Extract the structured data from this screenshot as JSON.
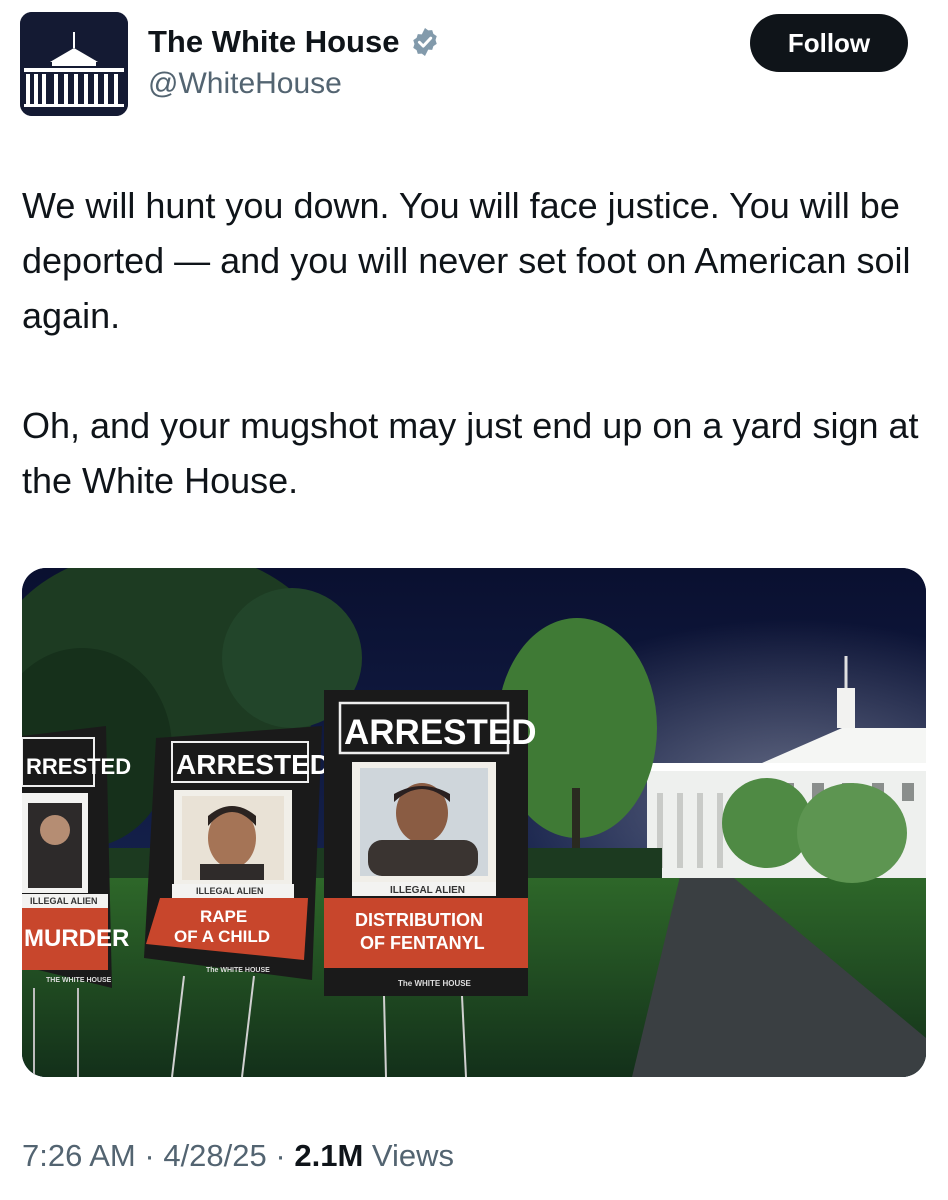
{
  "author": {
    "display_name": "The White House",
    "handle": "@WhiteHouse",
    "verified": true,
    "avatar_icon": "white-house-logo-icon"
  },
  "actions": {
    "follow_label": "Follow"
  },
  "tweet": {
    "paragraphs": [
      "We will hunt you down. You will face justice. You will be deported — and you will never set foot on American soil again.",
      "Oh, and your mugshot may just end up on a yard sign at the White House."
    ]
  },
  "media": {
    "signs": [
      {
        "header": "RRESTED",
        "tag": "ILLEGAL ALIEN",
        "crime_line1": "MURDER",
        "crime_line2": "",
        "footer": "THE WHITE HOUSE"
      },
      {
        "header": "ARRESTED",
        "tag": "ILLEGAL ALIEN",
        "crime_line1": "RAPE",
        "crime_line2": "OF A CHILD",
        "footer": "The WHITE HOUSE"
      },
      {
        "header": "ARRESTED",
        "tag": "ILLEGAL ALIEN",
        "crime_line1": "DISTRIBUTION",
        "crime_line2": "OF FENTANYL",
        "footer": "The WHITE HOUSE"
      }
    ]
  },
  "meta": {
    "time": "7:26 AM",
    "separator": "·",
    "date": "4/28/25",
    "views_count": "2.1M",
    "views_label": "Views"
  },
  "colors": {
    "text_primary": "#0f1419",
    "text_secondary": "#536471",
    "verified_badge": "#829aab",
    "sign_red": "#c8462c",
    "sign_black": "#1a1a1a"
  }
}
